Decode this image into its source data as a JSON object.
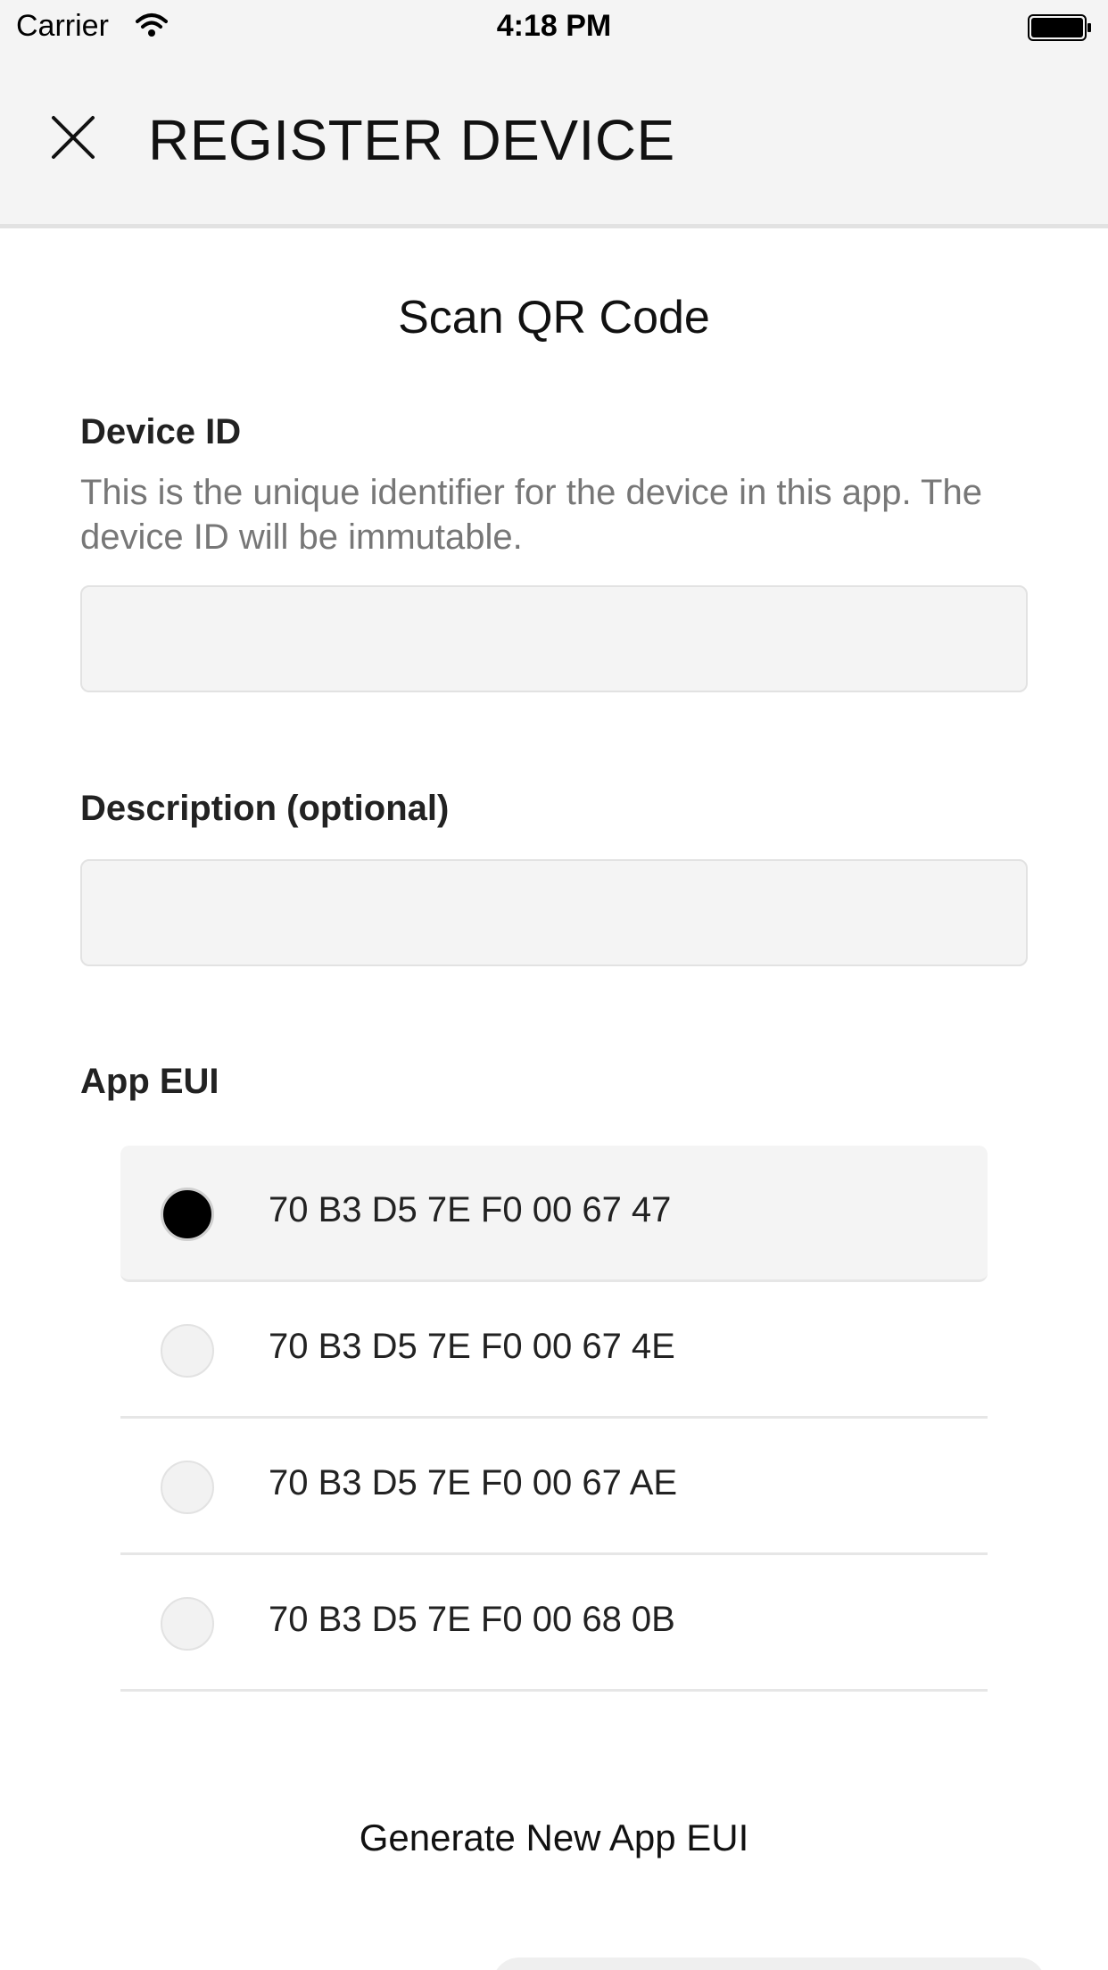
{
  "status_bar": {
    "carrier": "Carrier",
    "time": "4:18 PM",
    "icons": [
      "wifi-icon",
      "battery-icon"
    ]
  },
  "nav": {
    "title": "REGISTER DEVICE",
    "close_icon": "close-icon"
  },
  "scan_qr_label": "Scan QR Code",
  "device_id": {
    "label": "Device ID",
    "help": "This is the unique identifier for the device in this app. The device ID will be immutable.",
    "value": ""
  },
  "description": {
    "label": "Description (optional)",
    "value": ""
  },
  "app_eui": {
    "label": "App EUI",
    "selected_index": 0,
    "options": [
      "70 B3 D5 7E F0 00 67 47",
      "70 B3 D5 7E F0 00 67 4E",
      "70 B3 D5 7E F0 00 67 AE",
      "70 B3 D5 7E F0 00 68 0B"
    ]
  },
  "generate_label": "Generate New App EUI"
}
